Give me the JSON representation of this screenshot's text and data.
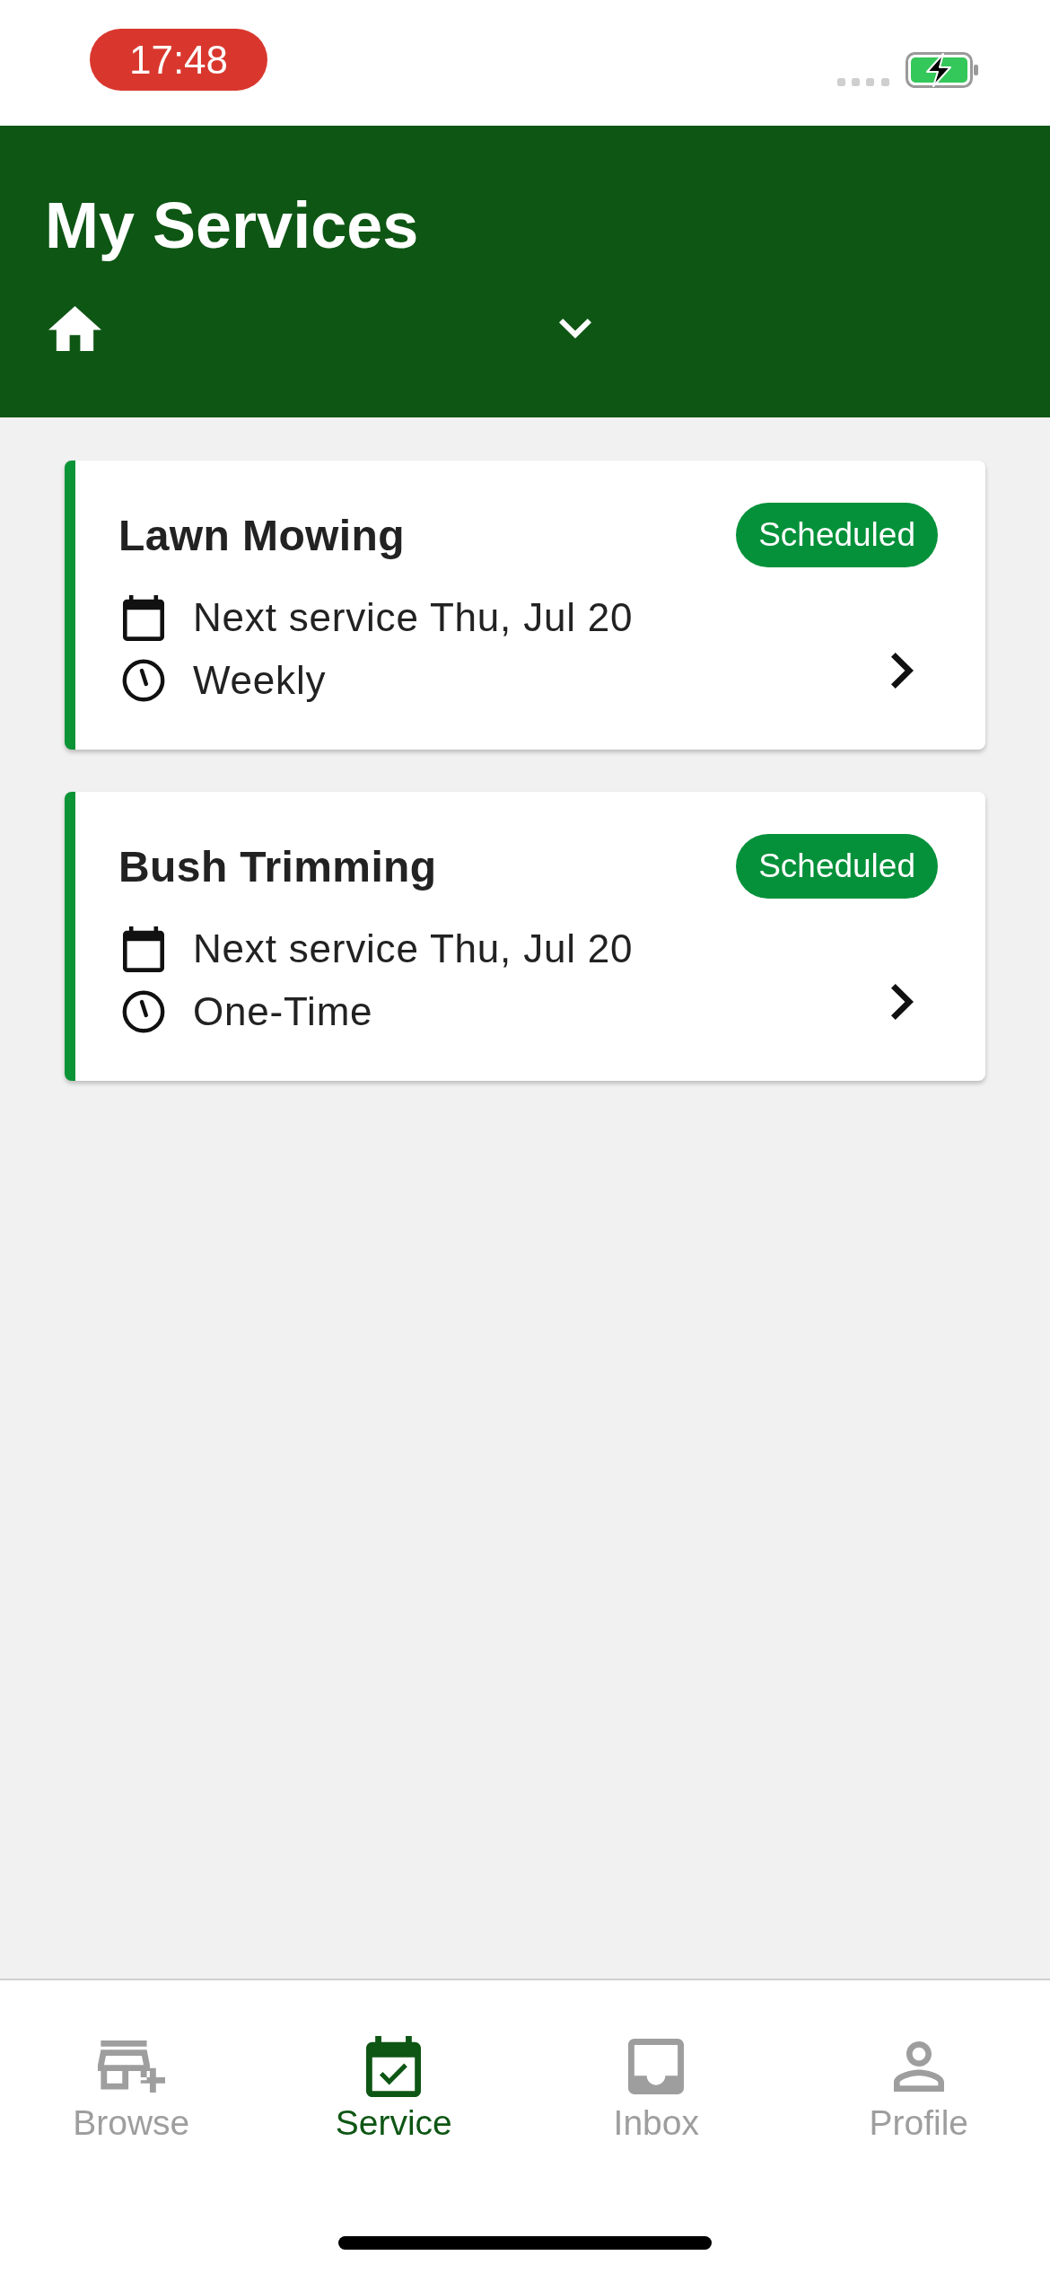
{
  "status_bar": {
    "time": "17:48"
  },
  "header": {
    "title": "My Services"
  },
  "services": [
    {
      "name": "Lawn Mowing",
      "status": "Scheduled",
      "next_service": "Next service Thu, Jul 20",
      "frequency": "Weekly"
    },
    {
      "name": "Bush Trimming",
      "status": "Scheduled",
      "next_service": "Next service Thu, Jul 20",
      "frequency": "One-Time"
    }
  ],
  "tab_bar": {
    "items": [
      {
        "label": "Browse",
        "selected": false
      },
      {
        "label": "Service",
        "selected": true
      },
      {
        "label": "Inbox",
        "selected": false
      },
      {
        "label": "Profile",
        "selected": false
      }
    ]
  }
}
